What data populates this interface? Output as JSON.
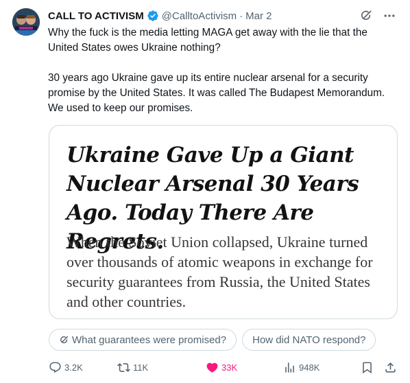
{
  "author": {
    "name": "CALL TO ACTIVISM",
    "handle": "@CalltoActivism",
    "separator": "·",
    "date": "Mar 2"
  },
  "tweet": {
    "paragraph1": "Why the fuck is the media letting MAGA get away with the lie that the United States owes Ukraine nothing?",
    "paragraph2": "30 years ago Ukraine gave up its entire nuclear arsenal for a security promise by the United States. It was called The Budapest Memorandum. We used to keep our promises."
  },
  "card": {
    "headline": "Ukraine Gave Up a Giant Nuclear Arsenal 30 Years Ago. Today There Are Regrets.",
    "summary": "When the Soviet Union collapsed, Ukraine turned over thousands of atomic weapons in exchange for security guarantees from Russia, the United States and other countries."
  },
  "chips": [
    {
      "label": "What guarantees were promised?",
      "icon": "grok-icon"
    },
    {
      "label": "How did NATO respond?"
    }
  ],
  "actions": {
    "replies": "3.2K",
    "reposts": "11K",
    "likes": "33K",
    "views": "948K"
  },
  "colors": {
    "text": "#0f1419",
    "muted": "#536471",
    "verified": "#1d9bf0",
    "like": "#f91880",
    "border": "#cfd9de"
  }
}
